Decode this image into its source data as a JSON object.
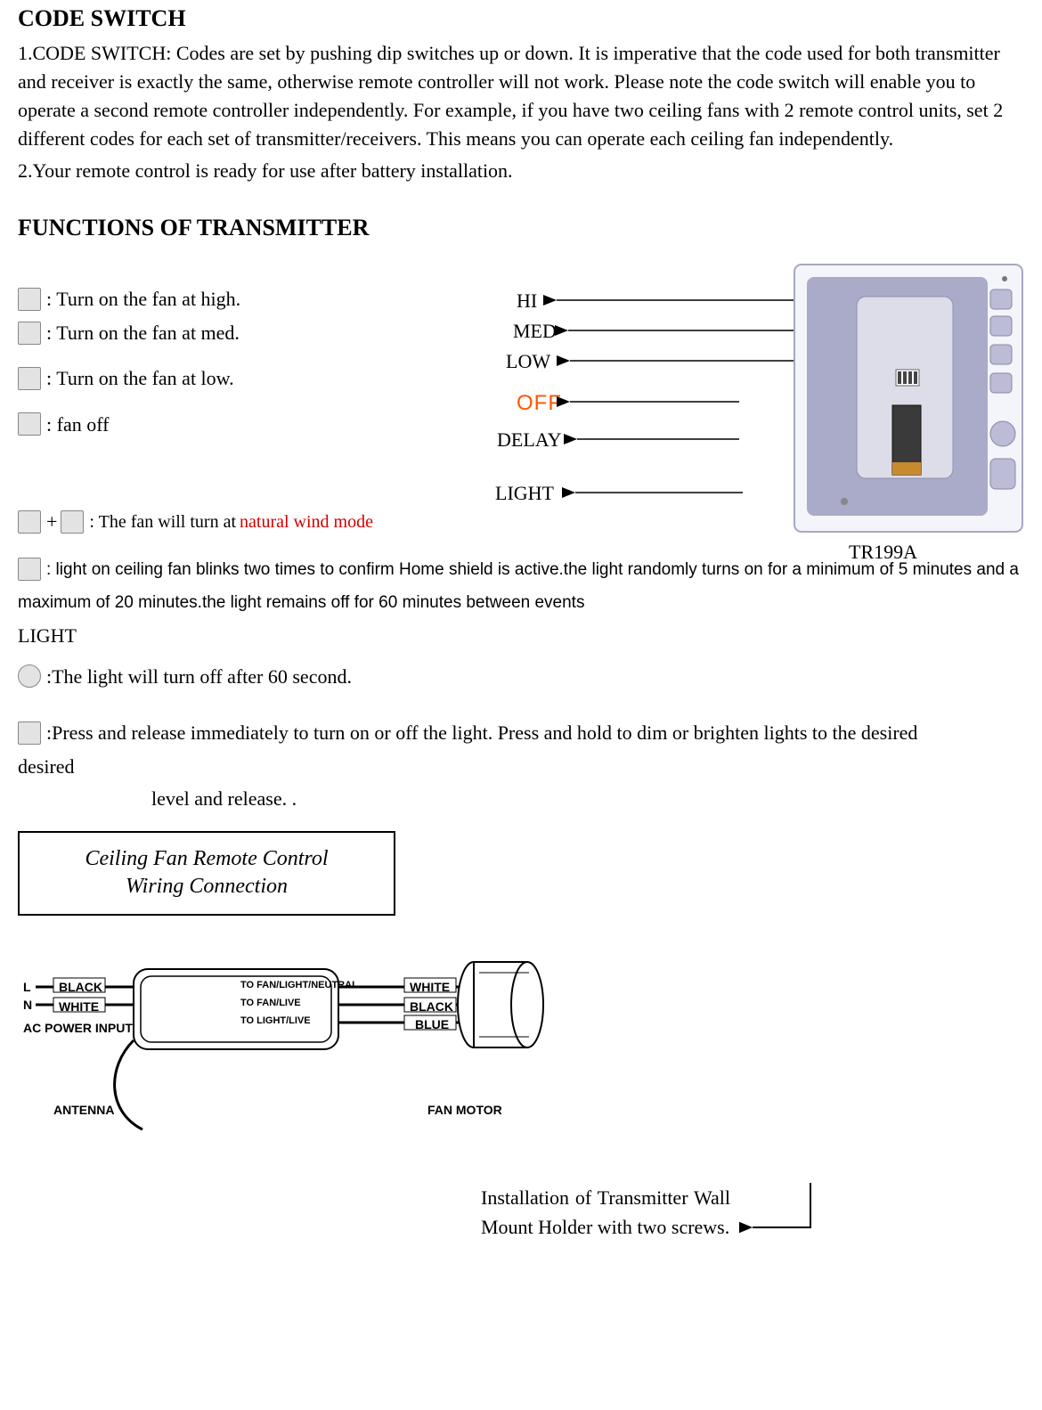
{
  "code_switch": {
    "heading": "CODE SWITCH",
    "item1_lead": "1.CODE SWITCH: ",
    "item1_text": "Codes are set by pushing dip switches up or down. It is imperative that the code used for both transmitter and receiver is exactly the same, otherwise remote controller will not work. Please note the code switch will enable you to operate a second remote controller independently. For example, if you have two ceiling fans with 2 remote control units, set 2 different codes for each set of transmitter/receivers. This means you can operate each ceiling fan independently.",
    "item2": "2.Your remote control is ready for use after battery installation."
  },
  "functions": {
    "heading": "FUNCTIONS OF TRANSMITTER",
    "hi_desc": ": Turn on the fan at high.",
    "med_desc": ": Turn on the fan at med.",
    "low_desc": ": Turn on the fan at low.",
    "off_desc": ": fan off",
    "nat_wind_pre": ": The fan will turn at ",
    "nat_wind_red": "natural wind mode",
    "home_shield_pre": ":  light on ceiling fan blinks two times to confirm Home shield is active.the light randomly turns on for a minimum of 5 minutes and a maximum of 20 minutes.the light remains off for 60 minutes between events",
    "light_header": "LIGHT",
    "delay_desc": ":The light will turn off after 60 second.",
    "light_desc": ":Press and release immediately to turn on or off the light. Press and hold to dim or brighten lights to the desired",
    "light_desc2": "level and release. .",
    "labels": {
      "hi": "HI",
      "med": "MED",
      "low": "LOW",
      "off": "OFF",
      "delay": "DELAY",
      "light": "LIGHT"
    },
    "model": "TR199A"
  },
  "wiring": {
    "title_l1": "Ceiling Fan Remote Control",
    "title_l2": "Wiring Connection",
    "labels": {
      "L": "L",
      "N": "N",
      "black": "BLACK",
      "white": "WHITE",
      "ac_power": "AC POWER INPUT",
      "antenna": "ANTENNA",
      "to_neutral": "TO FAN/LIGHT/NEUTRAL",
      "to_fan_live": "TO FAN/LIVE",
      "to_light_live": "TO LIGHT/LIVE",
      "white2": "WHITE",
      "black2": "BLACK",
      "blue": "BLUE",
      "fan_motor": "FAN MOTOR"
    }
  },
  "install": {
    "text": "Installation of Transmitter Wall Mount Holder with two screws."
  }
}
